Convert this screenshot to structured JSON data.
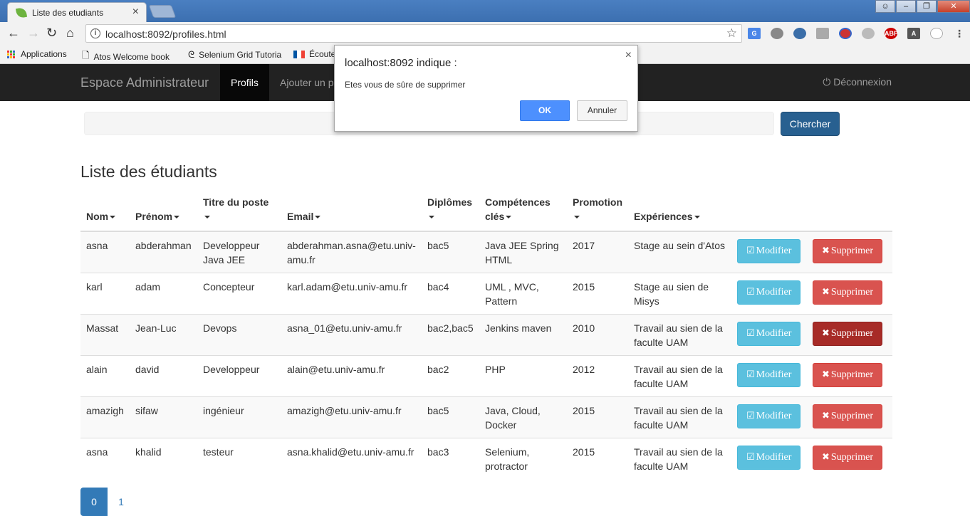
{
  "browser": {
    "tab_title": "Liste des etudiants",
    "url": "localhost:8092/profiles.html",
    "bookmarks": [
      {
        "label": "Applications",
        "icon": "apps-grid-icon"
      },
      {
        "label": "Atos Welcome book",
        "icon": "page-icon"
      },
      {
        "label": "Selenium Grid Tutoria",
        "icon": "selenium-icon"
      },
      {
        "label": "Écoute",
        "icon": "french-flag-icon"
      }
    ]
  },
  "app": {
    "brand": "Espace Administrateur",
    "nav": [
      {
        "label": "Profils",
        "active": true
      },
      {
        "label": "Ajouter un p",
        "active": false
      }
    ],
    "logout_label": "Déconnexion",
    "search_button": "Chercher",
    "heading": "Liste des étudiants",
    "columns": [
      {
        "line1": "Nom",
        "line2": ""
      },
      {
        "line1": "Prénom",
        "line2": ""
      },
      {
        "line1": "Titre du poste",
        "line2": ""
      },
      {
        "line1": "Email",
        "line2": ""
      },
      {
        "line1": "Diplômes",
        "line2": ""
      },
      {
        "line1": "Compétences",
        "line2": "clés"
      },
      {
        "line1": "Promotion",
        "line2": ""
      },
      {
        "line1": "Expériences",
        "line2": ""
      }
    ],
    "modify_label": "Modifier",
    "delete_label": "Supprimer",
    "rows": [
      {
        "nom": "asna",
        "prenom": "abderahman",
        "titre": "Developpeur Java JEE",
        "email": "abderahman.asna@etu.univ-amu.fr",
        "diplomes": "bac5",
        "competences": "Java JEE Spring HTML",
        "promotion": "2017",
        "experiences": "Stage au sein d'Atos"
      },
      {
        "nom": "karl",
        "prenom": "adam",
        "titre": "Concepteur",
        "email": "karl.adam@etu.univ-amu.fr",
        "diplomes": "bac4",
        "competences": "UML , MVC, Pattern",
        "promotion": "2015",
        "experiences": "Stage au sien de Misys"
      },
      {
        "nom": "Massat",
        "prenom": "Jean-Luc",
        "titre": "Devops",
        "email": "asna_01@etu.univ-amu.fr",
        "diplomes": "bac2,bac5",
        "competences": "Jenkins maven",
        "promotion": "2010",
        "experiences": "Travail au sien de la faculte UAM"
      },
      {
        "nom": "alain",
        "prenom": "david",
        "titre": "Developpeur",
        "email": "alain@etu.univ-amu.fr",
        "diplomes": "bac2",
        "competences": "PHP",
        "promotion": "2012",
        "experiences": "Travail au sien de la faculte UAM"
      },
      {
        "nom": "amazigh",
        "prenom": "sifaw",
        "titre": "ingénieur",
        "email": "amazigh@etu.univ-amu.fr",
        "diplomes": "bac5",
        "competences": "Java, Cloud, Docker",
        "promotion": "2015",
        "experiences": "Travail au sien de la faculte UAM"
      },
      {
        "nom": "asna",
        "prenom": "khalid",
        "titre": "testeur",
        "email": "asna.khalid@etu.univ-amu.fr",
        "diplomes": "bac3",
        "competences": "Selenium, protractor",
        "promotion": "2015",
        "experiences": "Travail au sien de la faculte UAM"
      }
    ],
    "hovered_delete_row": 2,
    "pages": [
      "0",
      "1"
    ],
    "active_page": 0
  },
  "dialog": {
    "title": "localhost:8092 indique :",
    "message": "Etes vous de sûre de supprimer",
    "ok": "OK",
    "cancel": "Annuler"
  },
  "colors": {
    "navbar": "#222222",
    "primary": "#337ab7",
    "info": "#5bc0de",
    "danger": "#d9534f",
    "dialog_ok": "#4d90fe"
  }
}
